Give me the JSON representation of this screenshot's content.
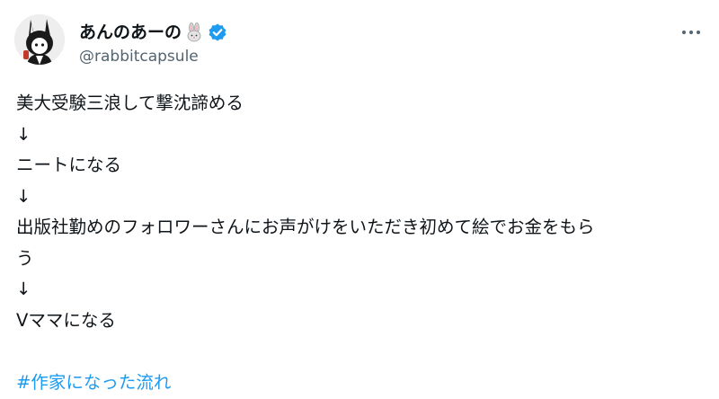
{
  "author": {
    "display_name": "あんのあーの",
    "name_emoji": "rabbit-emoji",
    "handle": "@rabbitcapsule",
    "verified": true,
    "avatar_icon": "avatar-rabbit-illustration"
  },
  "menu": {
    "icon": "more-horizontal-icon"
  },
  "tweet": {
    "lines": [
      "美大受験三浪して撃沈諦める",
      "↓",
      "ニートになる",
      "↓",
      "出版社勤めのフォロワーさんにお声がけをいただき初めて絵でお金をもら",
      "う",
      "↓",
      "Vママになる"
    ],
    "hashtag": "#作家になった流れ"
  },
  "colors": {
    "text": "#0f1419",
    "secondary": "#536471",
    "link": "#1d9bf0",
    "verified": "#1d9bf0"
  }
}
